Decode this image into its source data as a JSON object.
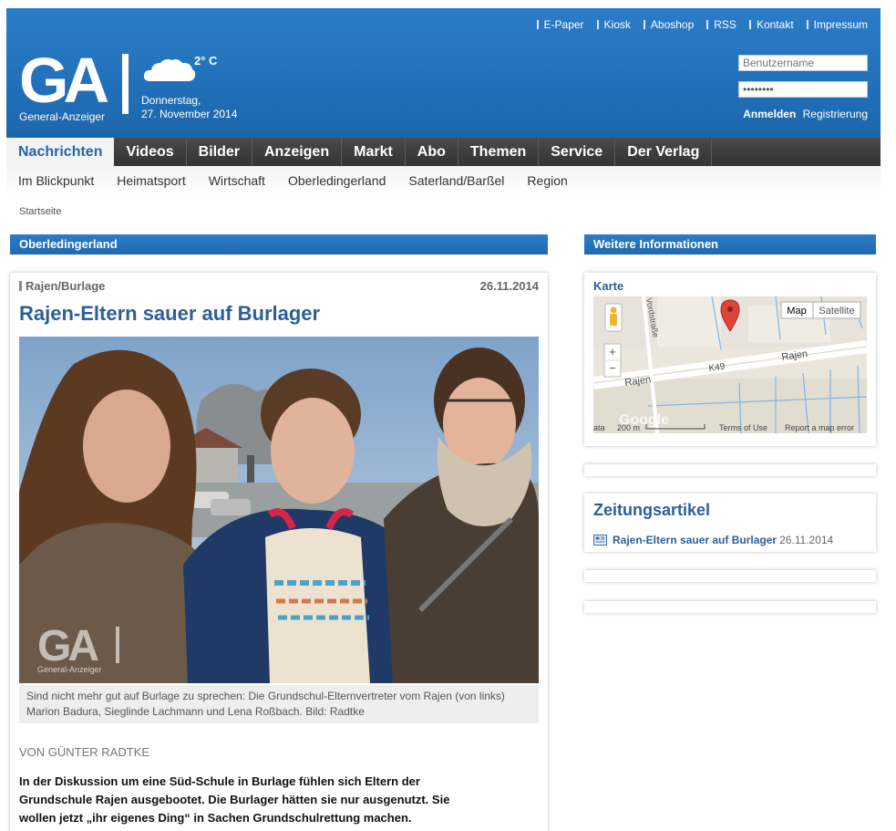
{
  "topnav": [
    "E-Paper",
    "Kiosk",
    "Aboshop",
    "RSS",
    "Kontakt",
    "Impressum"
  ],
  "logo": {
    "mark": "GA",
    "subtitle": "General-Anzeiger"
  },
  "weather": {
    "temp": "2° C",
    "icon": "cloud-icon"
  },
  "date": {
    "weekday": "Donnerstag,",
    "day": "27. November 2014"
  },
  "login": {
    "username_placeholder": "Benutzername",
    "password_value": "••••••••",
    "login_label": "Anmelden",
    "register_label": "Registrierung"
  },
  "mainnav": [
    "Nachrichten",
    "Videos",
    "Bilder",
    "Anzeigen",
    "Markt",
    "Abo",
    "Themen",
    "Service",
    "Der Verlag"
  ],
  "subnav": [
    "Im Blickpunkt",
    "Heimatsport",
    "Wirtschaft",
    "Oberledingerland",
    "Saterland/Barßel",
    "Region"
  ],
  "breadcrumb": "Startseite",
  "section": {
    "left": "Oberledingerland",
    "right": "Weitere Informationen"
  },
  "article": {
    "kicker": "Rajen/Burlage",
    "date": "26.11.2014",
    "title": "Rajen-Eltern sauer auf Burlager",
    "caption_line1": "Sind nicht mehr gut auf Burlage zu sprechen: Die Grundschul-Elternvertreter vom Rajen (von links)",
    "caption_line2": "Marion Badura, Sieglinde Lachmann und Lena Roßbach. Bild: Radtke",
    "watermark_mark": "GA",
    "watermark_sub": "General-Anzeiger",
    "byline": "VON GÜNTER RADTKE",
    "lead_line1": "In der Diskussion um eine Süd-Schule in Burlage fühlen sich Eltern der",
    "lead_line2": "Grundschule Rajen ausgebootet. Die Burlager hätten sie nur ausgenutzt. Sie",
    "lead_line3": "wollen jetzt „ihr eigenes Ding“ in Sachen Grundschulrettung machen."
  },
  "map": {
    "title": "Karte",
    "btn_map": "Map",
    "btn_satellite": "Satellite",
    "zoom_in": "+",
    "zoom_out": "−",
    "road_k49": "K49",
    "road_rajen1": "Rajen",
    "road_rajen2": "Rajen",
    "road_vord": "Vordstraße",
    "google": "Google",
    "scale": "200 m",
    "data_label": "ata",
    "terms": "Terms of Use",
    "report": "Report a map error"
  },
  "zeitungsartikel": {
    "title": "Zeitungsartikel",
    "link": "Rajen-Eltern sauer auf Burlager",
    "date": "26.11.2014"
  },
  "colors": {
    "brand_blue": "#2170ba",
    "link_blue": "#2d5e9a",
    "nav_dark": "#3a3a3a"
  }
}
